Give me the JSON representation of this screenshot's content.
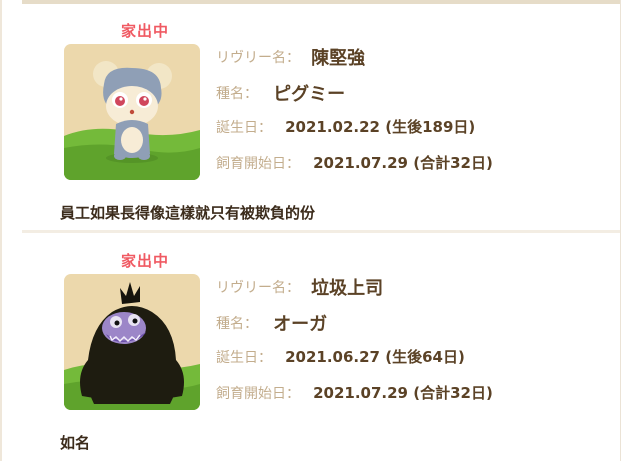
{
  "labels": {
    "name": "リヴリー名：",
    "species": "種名：",
    "birthday": "誕生日：",
    "start": "飼育開始日："
  },
  "pets": [
    {
      "status": "家出中",
      "name": "陳堅強",
      "species": "ピグミー",
      "birthday": "2021.02.22 (生後189日)",
      "start": "2021.07.29 (合計32日)",
      "comment": "員工如果長得像這樣就只有被欺負的份"
    },
    {
      "status": "家出中",
      "name": "垃圾上司",
      "species": "オーガ",
      "birthday": "2021.06.27 (生後64日)",
      "start": "2021.07.29 (合計32日)",
      "comment": "如名"
    }
  ],
  "icons": {
    "pet_0": "pygmy-creature-icon",
    "pet_1": "ogre-creature-icon"
  },
  "colors": {
    "status_red": "#f05a63",
    "label_tan": "#c3ad8d",
    "value_brown": "#5b4226"
  }
}
